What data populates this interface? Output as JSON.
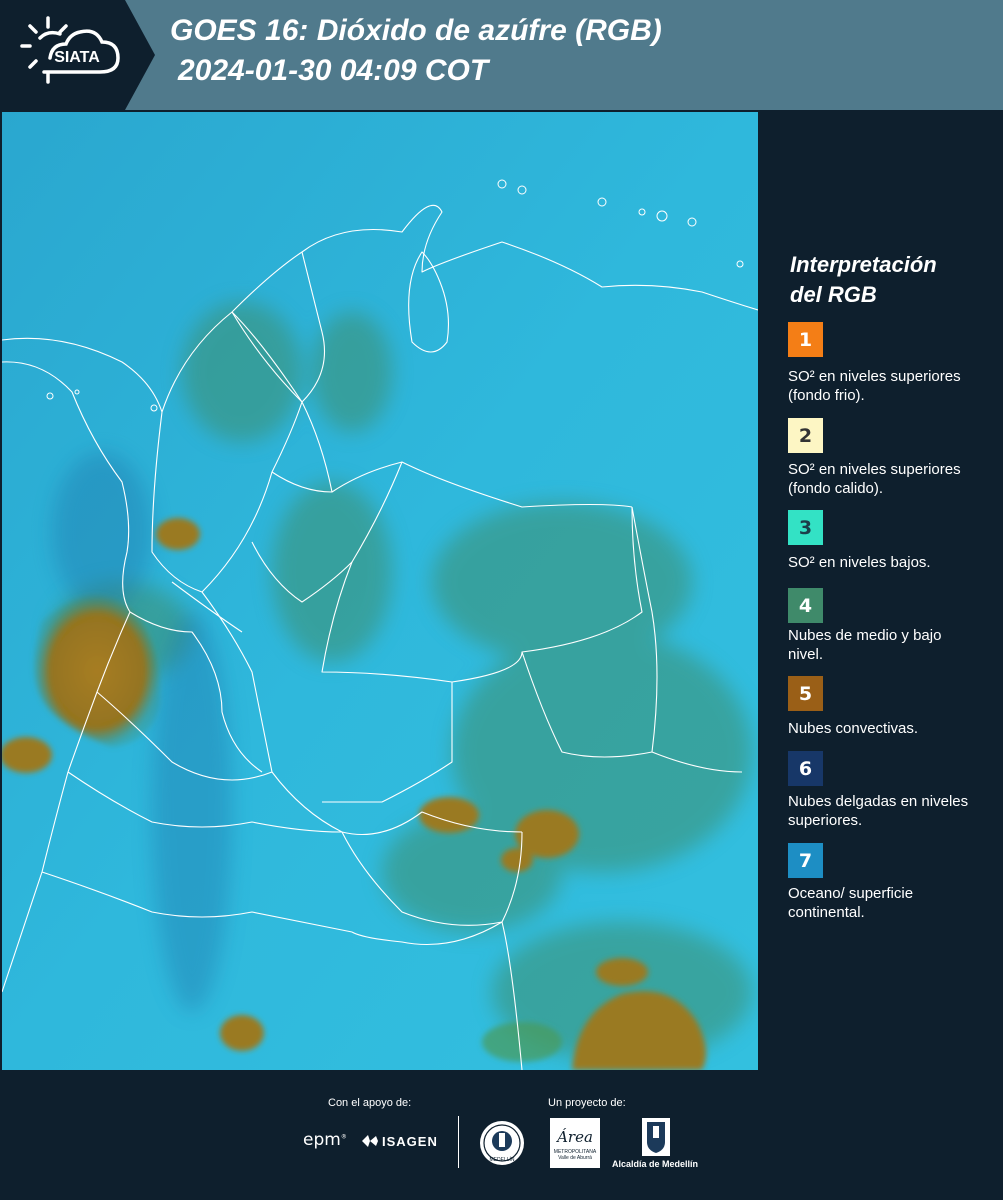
{
  "header": {
    "brand": "SIATA",
    "title_line1": "GOES 16: Dióxido de azúfre (RGB)",
    "title_line2": "2024-01-30 04:09 COT"
  },
  "legend": {
    "title_line1": "Interpretación",
    "title_line2": "del RGB",
    "items": [
      {
        "number": "1",
        "color": "#f47e16",
        "text_color": "#ffffff",
        "label": "SO² en niveles superiores (fondo frio)."
      },
      {
        "number": "2",
        "color": "#fdf6c4",
        "text_color": "#333333",
        "label": "SO² en niveles superiores (fondo calido)."
      },
      {
        "number": "3",
        "color": "#33e2c5",
        "text_color": "#1c3e4a",
        "label": "SO² en niveles bajos."
      },
      {
        "number": "4",
        "color": "#3f8a6a",
        "text_color": "#ffffff",
        "label": "Nubes de medio y bajo nivel."
      },
      {
        "number": "5",
        "color": "#9a5f17",
        "text_color": "#ffffff",
        "label": "Nubes convectivas."
      },
      {
        "number": "6",
        "color": "#173768",
        "text_color": "#ffffff",
        "label": "Nubes delgadas en niveles superiores."
      },
      {
        "number": "7",
        "color": "#1d8ec4",
        "text_color": "#ffffff",
        "label": "Oceano/ superficie continental."
      }
    ]
  },
  "footer": {
    "support_label": "Con el apoyo de:",
    "project_label": "Un proyecto de:",
    "sponsor1": "epm",
    "sponsor2": "ISAGEN",
    "partner_seal": "MEDELLÍN",
    "partner_area": "Área",
    "partner_area_sub1": "METROPOLITANA",
    "partner_area_sub2": "Valle de Aburrá",
    "partner_alcaldia": "Alcaldía de Medellín"
  },
  "colors": {
    "header_bg": "#507a8c",
    "dark_bg": "#0e1f2d",
    "map_surface": "#2fb6da",
    "map_low_clouds": "#3f8a6a",
    "map_convective": "#9a7a25",
    "border_lines": "#ffffff"
  }
}
